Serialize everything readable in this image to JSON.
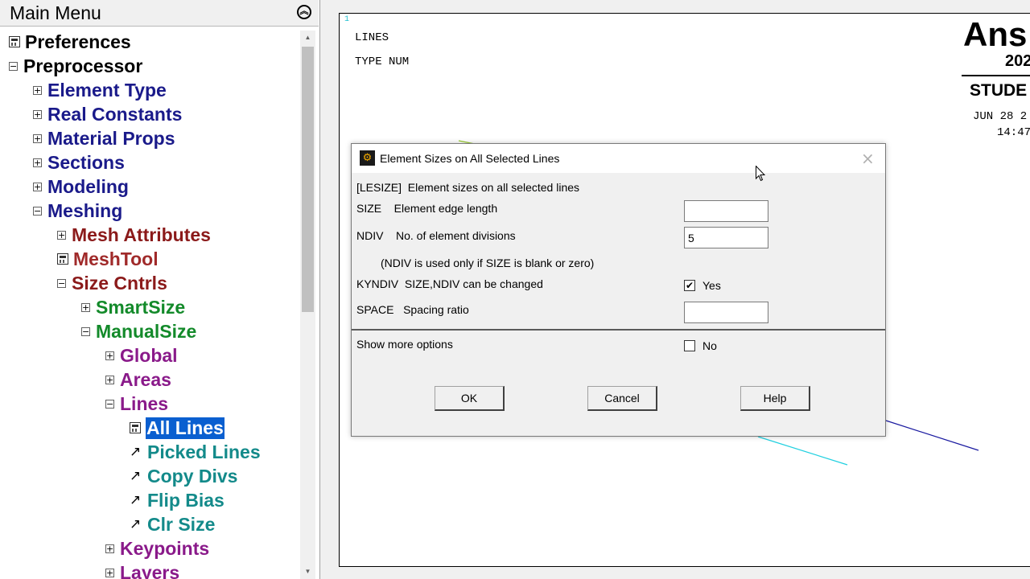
{
  "main_menu": {
    "title": "Main Menu",
    "collapse_icon": "double-chevron-up-icon",
    "items": [
      {
        "label": "Preferences",
        "icon": "calc",
        "level": 0,
        "color": "#000000"
      },
      {
        "label": "Preprocessor",
        "icon": "minus",
        "level": 0,
        "color": "#000000"
      },
      {
        "label": "Element Type",
        "icon": "plus",
        "level": 1,
        "color": "#1a1a8a"
      },
      {
        "label": "Real Constants",
        "icon": "plus",
        "level": 1,
        "color": "#1a1a8a"
      },
      {
        "label": "Material Props",
        "icon": "plus",
        "level": 1,
        "color": "#1a1a8a"
      },
      {
        "label": "Sections",
        "icon": "plus",
        "level": 1,
        "color": "#1a1a8a"
      },
      {
        "label": "Modeling",
        "icon": "plus",
        "level": 1,
        "color": "#1a1a8a"
      },
      {
        "label": "Meshing",
        "icon": "minus",
        "level": 1,
        "color": "#1a1a8a"
      },
      {
        "label": "Mesh Attributes",
        "icon": "plus",
        "level": 2,
        "color": "#8b1a1a"
      },
      {
        "label": "MeshTool",
        "icon": "calc",
        "level": 2,
        "color": "#a02a2a"
      },
      {
        "label": "Size Cntrls",
        "icon": "minus",
        "level": 2,
        "color": "#8b1a1a"
      },
      {
        "label": "SmartSize",
        "icon": "plus",
        "level": 3,
        "color": "#138a2a"
      },
      {
        "label": "ManualSize",
        "icon": "minus",
        "level": 3,
        "color": "#138a2a"
      },
      {
        "label": "Global",
        "icon": "plus",
        "level": 4,
        "color": "#8a1a8a"
      },
      {
        "label": "Areas",
        "icon": "plus",
        "level": 4,
        "color": "#8a1a8a"
      },
      {
        "label": "Lines",
        "icon": "minus",
        "level": 4,
        "color": "#8a1a8a"
      },
      {
        "label": "All Lines",
        "icon": "calc",
        "level": 5,
        "color": "#138a8a",
        "selected": true
      },
      {
        "label": "Picked Lines",
        "icon": "arrow",
        "level": 5,
        "color": "#138a8a"
      },
      {
        "label": "Copy Divs",
        "icon": "arrow",
        "level": 5,
        "color": "#138a8a"
      },
      {
        "label": "Flip Bias",
        "icon": "arrow",
        "level": 5,
        "color": "#138a8a"
      },
      {
        "label": "Clr Size",
        "icon": "arrow",
        "level": 5,
        "color": "#138a8a"
      },
      {
        "label": "Keypoints",
        "icon": "plus",
        "level": 4,
        "color": "#8a1a8a"
      },
      {
        "label": "Layers",
        "icon": "plus",
        "level": 4,
        "color": "#8a1a8a"
      }
    ]
  },
  "graphics": {
    "window_number": "1",
    "line1": "LINES",
    "line2": "TYPE NUM",
    "logo": "Ans",
    "logo_year": "202",
    "logo_edition": "STUDE",
    "date": "JUN 28 2",
    "time": "14:47"
  },
  "dialog": {
    "title": "Element Sizes on All Selected Lines",
    "header_text": "[LESIZE]  Element sizes on all selected lines",
    "size_label": "SIZE    Element edge length",
    "size_value": "",
    "ndiv_label": "NDIV    No. of element divisions",
    "ndiv_value": "5",
    "ndiv_note": "(NDIV is used only if SIZE is blank or zero)",
    "kyndiv_label": "KYNDIV  SIZE,NDIV can be changed",
    "kyndiv_state": "Yes",
    "space_label": "SPACE   Spacing ratio",
    "space_value": "",
    "more_label": "Show more options",
    "more_state": "No",
    "ok_label": "OK",
    "cancel_label": "Cancel",
    "help_label": "Help"
  }
}
